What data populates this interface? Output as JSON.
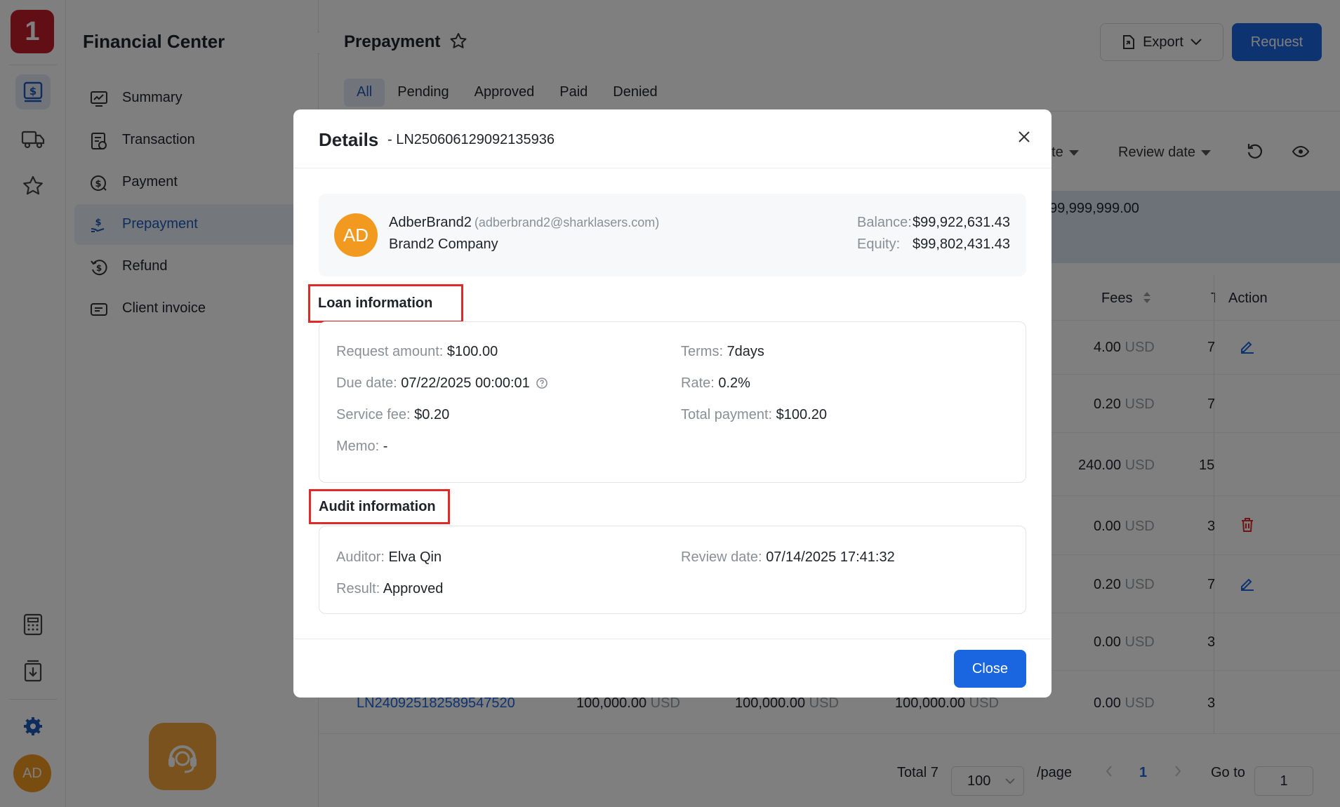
{
  "app": {
    "logo_text": "1",
    "user_initials": "AD"
  },
  "sidebar": {
    "title": "Financial Center",
    "items": [
      {
        "label": "Summary",
        "icon": "monitor-chart-icon",
        "active": false
      },
      {
        "label": "Transaction",
        "icon": "ledger-icon",
        "active": false
      },
      {
        "label": "Payment",
        "icon": "dollar-coin-icon",
        "active": false
      },
      {
        "label": "Prepayment",
        "icon": "hand-dollar-icon",
        "active": true
      },
      {
        "label": "Refund",
        "icon": "refund-icon",
        "active": false
      },
      {
        "label": "Client invoice",
        "icon": "invoice-icon",
        "active": false
      }
    ]
  },
  "header": {
    "title": "Prepayment",
    "export_label": "Export",
    "request_label": "Request"
  },
  "tabs": [
    {
      "label": "All",
      "active": true
    },
    {
      "label": "Pending",
      "active": false
    },
    {
      "label": "Approved",
      "active": false
    },
    {
      "label": "Paid",
      "active": false
    },
    {
      "label": "Denied",
      "active": false
    }
  ],
  "filters": {
    "partial_label": "ate",
    "review_date_label": "Review date"
  },
  "summary": {
    "partial_value": "99,999,999.00"
  },
  "table": {
    "headers": {
      "fees": "Fees",
      "partial_t": "T",
      "action": "Action"
    },
    "unit": "USD",
    "rows": [
      {
        "fees": "4.00",
        "t": "7",
        "action": "edit"
      },
      {
        "fees": "0.20",
        "t": "7",
        "action": ""
      },
      {
        "fees": "240.00",
        "t": "15",
        "action": ""
      },
      {
        "fees": "0.00",
        "t": "3",
        "action": "delete"
      },
      {
        "fees": "0.20",
        "t": "7",
        "action": "edit"
      },
      {
        "fees": "0.00",
        "t": "3",
        "action": ""
      }
    ],
    "last_row": {
      "id": "LN240925182589547520",
      "a1": "100,000.00",
      "a2": "100,000.00",
      "a3": "100,000.00",
      "fees": "0.00",
      "t": "3"
    }
  },
  "pagination": {
    "total_label": "Total 7",
    "page_size": "100",
    "per_page_label": "/page",
    "current_page": "1",
    "goto_label": "Go to",
    "goto_value": "1"
  },
  "modal": {
    "title": "Details",
    "subtitle": "- LN250606129092135936",
    "user": {
      "initials": "AD",
      "name": "AdberBrand2",
      "email": "(adberbrand2@sharklasers.com)",
      "company": "Brand2 Company",
      "balance_label": "Balance:",
      "balance_value": "$99,922,631.43",
      "equity_label": "Equity:",
      "equity_value": "$99,802,431.43"
    },
    "loan": {
      "section_title": "Loan information",
      "request_amount_label": "Request amount:",
      "request_amount_value": "$100.00",
      "terms_label": "Terms:",
      "terms_value": "7days",
      "due_date_label": "Due date:",
      "due_date_value": "07/22/2025 00:00:01",
      "rate_label": "Rate:",
      "rate_value": "0.2%",
      "service_fee_label": "Service fee:",
      "service_fee_value": "$0.20",
      "total_payment_label": "Total payment:",
      "total_payment_value": "$100.20",
      "memo_label": "Memo:",
      "memo_value": "-"
    },
    "audit": {
      "section_title": "Audit information",
      "auditor_label": "Auditor:",
      "auditor_value": "Elva Qin",
      "review_date_label": "Review date:",
      "review_date_value": "07/14/2025 17:41:32",
      "result_label": "Result:",
      "result_value": "Approved"
    },
    "close_label": "Close"
  },
  "colors": {
    "primary": "#1a66e0",
    "brand_red": "#c41d2a",
    "avatar_orange": "#f29a1f",
    "highlight_red": "#e02a2a"
  }
}
